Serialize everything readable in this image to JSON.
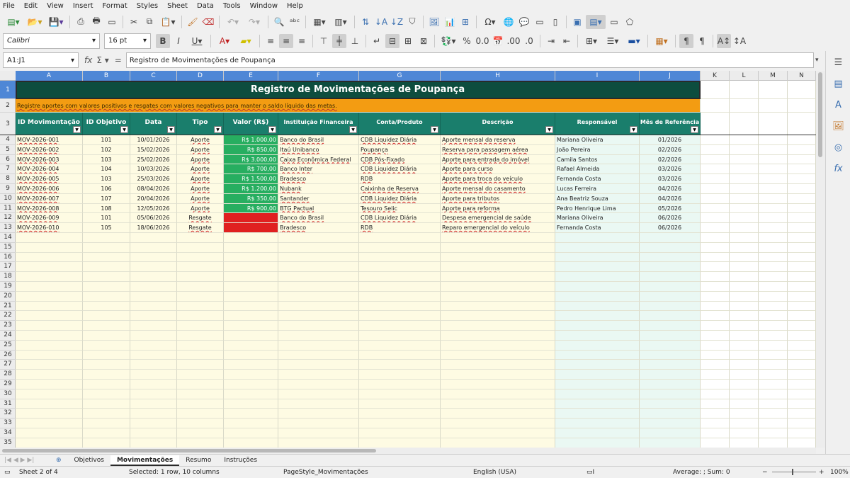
{
  "menu": [
    "File",
    "Edit",
    "View",
    "Insert",
    "Format",
    "Styles",
    "Sheet",
    "Data",
    "Tools",
    "Window",
    "Help"
  ],
  "font": {
    "name": "Calibri",
    "size": "16 pt"
  },
  "namebox": "A1:J1",
  "formula": "Registro de Movimentações de Poupança",
  "columns": [
    "A",
    "B",
    "C",
    "D",
    "E",
    "F",
    "G",
    "H",
    "I",
    "J",
    "K",
    "L",
    "M",
    "N"
  ],
  "title": "Registro de Movimentações de Poupança",
  "note": "Registre aportes com valores positivos e resgates com valores negativos para manter o saldo líquido das metas.",
  "headers": [
    "ID Movimentação",
    "ID Objetivo",
    "Data",
    "Tipo",
    "Valor (R$)",
    "Instituição Financeira",
    "Conta/Produto",
    "Descrição",
    "Responsável",
    "Mês de Referência"
  ],
  "rows": [
    [
      "MOV-2026-001",
      "101",
      "10/01/2026",
      "Aporte",
      "R$ 1.000,00",
      "Banco do Brasil",
      "CDB Liquidez Diária",
      "Aporte mensal da reserva",
      "Mariana Oliveira",
      "01/2026"
    ],
    [
      "MOV-2026-002",
      "102",
      "15/02/2026",
      "Aporte",
      "R$ 850,00",
      "Itaú Unibanco",
      "Poupança",
      "Reserva para passagem aérea",
      "João Pereira",
      "02/2026"
    ],
    [
      "MOV-2026-003",
      "103",
      "25/02/2026",
      "Aporte",
      "R$ 3.000,00",
      "Caixa Econômica Federal",
      "CDB Pós-Fixado",
      "Aporte para entrada do imóvel",
      "Camila Santos",
      "02/2026"
    ],
    [
      "MOV-2026-004",
      "104",
      "10/03/2026",
      "Aporte",
      "R$ 700,00",
      "Banco Inter",
      "CDB Liquidez Diária",
      "Aporte para curso",
      "Rafael Almeida",
      "03/2026"
    ],
    [
      "MOV-2026-005",
      "103",
      "25/03/2026",
      "Aporte",
      "R$ 1.500,00",
      "Bradesco",
      "RDB",
      "Aporte para troca do veículo",
      "Fernanda Costa",
      "03/2026"
    ],
    [
      "MOV-2026-006",
      "106",
      "08/04/2026",
      "Aporte",
      "R$ 1.200,00",
      "Nubank",
      "Caixinha de Reserva",
      "Aporte mensal do casamento",
      "Lucas Ferreira",
      "04/2026"
    ],
    [
      "MOV-2026-007",
      "107",
      "20/04/2026",
      "Aporte",
      "R$ 350,00",
      "Santander",
      "CDB Liquidez Diária",
      "Aporte para tributos",
      "Ana Beatriz Souza",
      "04/2026"
    ],
    [
      "MOV-2026-008",
      "108",
      "12/05/2026",
      "Aporte",
      "R$ 900,00",
      "BTG Pactual",
      "Tesouro Selic",
      "Aporte para reforma",
      "Pedro Henrique Lima",
      "05/2026"
    ],
    [
      "MOV-2026-009",
      "101",
      "05/06/2026",
      "Resgate",
      "",
      "Banco do Brasil",
      "CDB Liquidez Diária",
      "Despesa emergencial de saúde",
      "Mariana Oliveira",
      "06/2026"
    ],
    [
      "MOV-2026-010",
      "105",
      "18/06/2026",
      "Resgate",
      "",
      "Bradesco",
      "RDB",
      "Reparo emergencial do veículo",
      "Fernanda Costa",
      "06/2026"
    ]
  ],
  "row_numbers": [
    "1",
    "2",
    "3",
    "4",
    "5",
    "6",
    "7",
    "8",
    "9",
    "10",
    "11",
    "12",
    "13",
    "14",
    "15",
    "16",
    "17",
    "18",
    "19",
    "20",
    "21",
    "22",
    "23",
    "24",
    "25",
    "26",
    "27",
    "28",
    "29",
    "30",
    "31",
    "32",
    "33",
    "34",
    "35"
  ],
  "tabs": [
    "Objetivos",
    "Movimentações",
    "Resumo",
    "Instruções"
  ],
  "active_tab": "Movimentações",
  "status": {
    "sheet": "Sheet 2 of 4",
    "selection": "Selected: 1 row, 10 columns",
    "pagestyle": "PageStyle_Movimentações",
    "language": "English (USA)",
    "sum": "Average: ; Sum: 0",
    "zoom": "100%"
  }
}
